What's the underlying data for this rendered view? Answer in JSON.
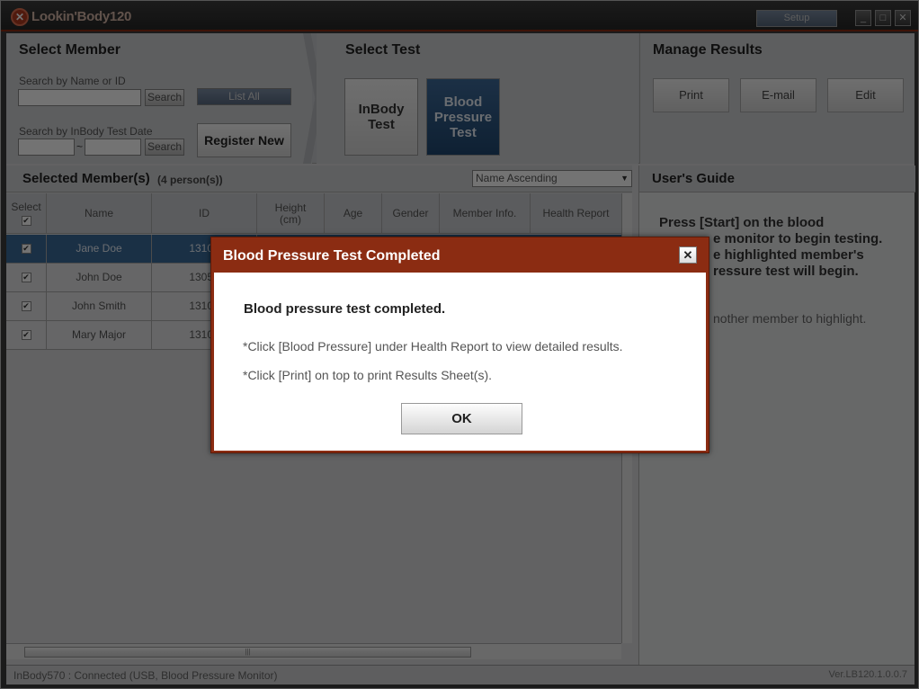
{
  "window": {
    "app_title": "Lookin'Body120",
    "setup_label": "Setup",
    "minimize": "_",
    "maximize": "□",
    "close": "✕"
  },
  "select_member": {
    "title": "Select Member",
    "search_name_label": "Search by Name or ID",
    "search_label": "Search",
    "list_all_label": "List All",
    "search_date_label": "Search by InBody Test Date",
    "date_sep": "~",
    "register_label": "Register New"
  },
  "select_test": {
    "title": "Select Test",
    "inbody_label": "InBody Test",
    "bp_label": "Blood Pressure Test"
  },
  "manage_results": {
    "title": "Manage Results",
    "print_label": "Print",
    "email_label": "E-mail",
    "edit_label": "Edit"
  },
  "member_list": {
    "title": "Selected Member(s)",
    "count": "(4 person(s))",
    "sort_value": "Name Ascending",
    "columns": [
      "Select",
      "Name",
      "ID",
      "Height (cm)",
      "Age",
      "Gender",
      "Member Info.",
      "Health Report"
    ],
    "rows": [
      {
        "name": "Jane Doe",
        "id": "13100"
      },
      {
        "name": "John Doe",
        "id": "13052"
      },
      {
        "name": "John Smith",
        "id": "13100"
      },
      {
        "name": "Mary Major",
        "id": "13100"
      }
    ]
  },
  "user_guide": {
    "title": "User's Guide",
    "text_1": "Press [Start] on the blood",
    "text_2": "e monitor to begin testing.",
    "text_3": "e highlighted member's",
    "text_4": "ressure test will begin.",
    "sub": "nother member to highlight."
  },
  "status": {
    "connection": "InBody570 : Connected (USB, Blood Pressure Monitor)",
    "version": "Ver.LB120.1.0.0.7"
  },
  "dialog": {
    "title": "Blood Pressure Test Completed",
    "close": "✕",
    "message": "Blood pressure test completed.",
    "hint_1": "*Click [Blood Pressure] under Health Report to view detailed results.",
    "hint_2": "*Click [Print] on top to print Results Sheet(s).",
    "ok_label": "OK"
  }
}
